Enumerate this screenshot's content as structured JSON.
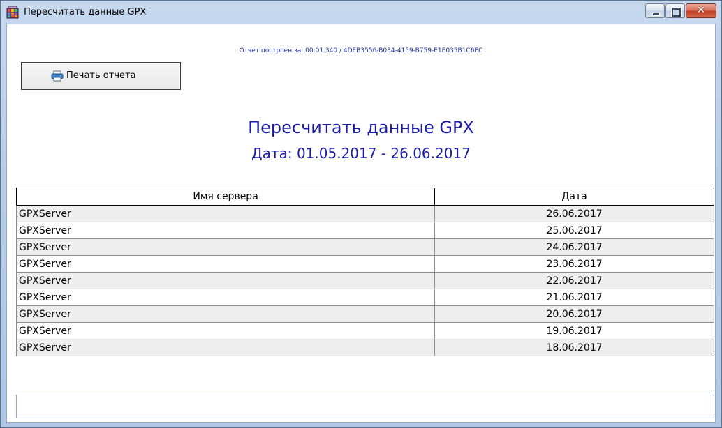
{
  "window": {
    "title": "Пересчитать данные GPX",
    "controls": {
      "minimize": "minimize-icon",
      "maximize": "maximize-icon",
      "close": "close-icon"
    },
    "close_glyph": "✕"
  },
  "report": {
    "info": "Отчет построен за: 00:01.340 / 4DEB3556-B034-4159-B759-E1E035B1C6EC",
    "print_button": "Печать отчета",
    "title": "Пересчитать данные GPX",
    "date_range": "Дата: 01.05.2017 - 26.06.2017"
  },
  "table": {
    "headers": {
      "server": "Имя сервера",
      "date": "Дата"
    },
    "rows": [
      {
        "server": "GPXServer",
        "date": "26.06.2017"
      },
      {
        "server": "GPXServer",
        "date": "25.06.2017"
      },
      {
        "server": "GPXServer",
        "date": "24.06.2017"
      },
      {
        "server": "GPXServer",
        "date": "23.06.2017"
      },
      {
        "server": "GPXServer",
        "date": "22.06.2017"
      },
      {
        "server": "GPXServer",
        "date": "21.06.2017"
      },
      {
        "server": "GPXServer",
        "date": "20.06.2017"
      },
      {
        "server": "GPXServer",
        "date": "19.06.2017"
      },
      {
        "server": "GPXServer",
        "date": "18.06.2017"
      }
    ]
  },
  "status": {
    "text": ""
  },
  "colors": {
    "accent": "#1c1ca8",
    "row_alt": "#eeeeee",
    "close_button": "#c23f25"
  }
}
